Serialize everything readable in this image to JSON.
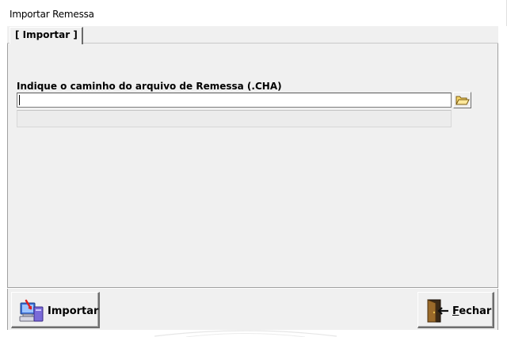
{
  "window": {
    "title": "Importar Remessa"
  },
  "tabs": [
    {
      "label": "[ Importar ]"
    }
  ],
  "form": {
    "prompt": "Indique o caminho do arquivo de Remessa (.CHA)",
    "path_value": "",
    "status_text": ""
  },
  "buttons": {
    "import": {
      "label": "Importar",
      "icon": "import-computer-icon"
    },
    "close": {
      "label_mnemonic": "F",
      "label_rest": "echar",
      "icon": "exit-door-icon"
    },
    "browse": {
      "icon": "open-folder-icon"
    }
  }
}
